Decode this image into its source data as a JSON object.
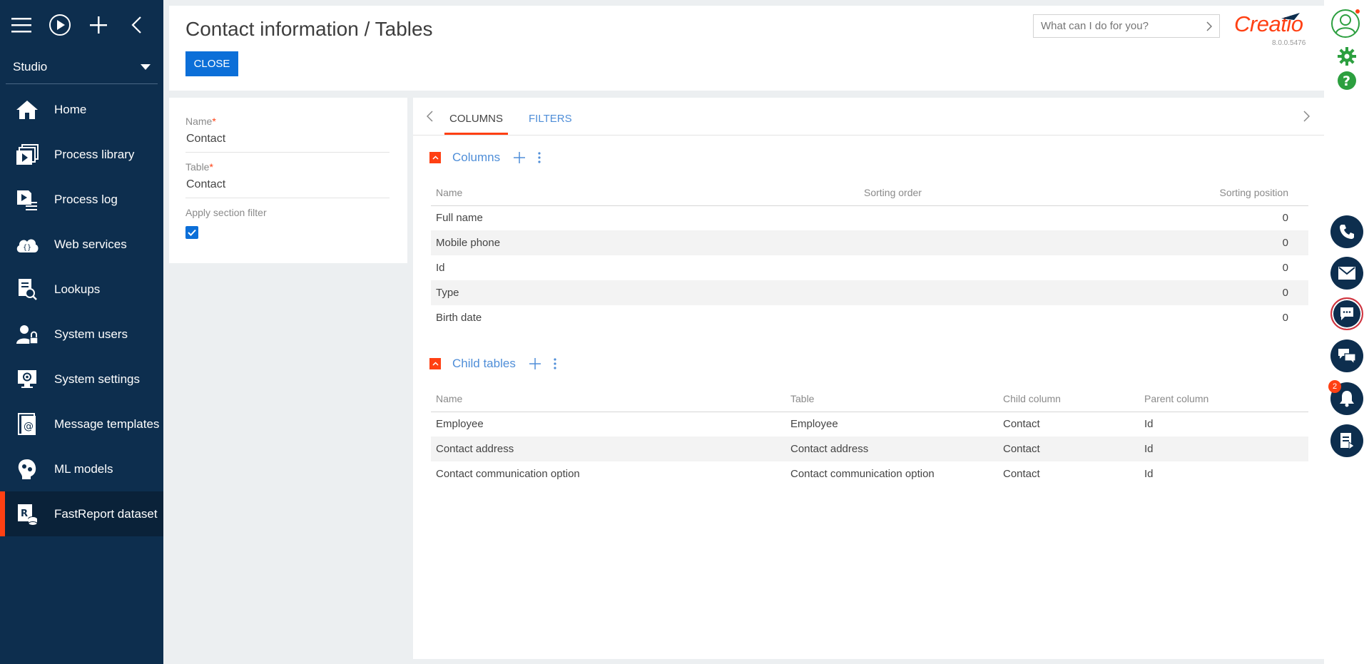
{
  "sidebar": {
    "studio_label": "Studio",
    "items": [
      {
        "label": "Home",
        "icon": "home-icon"
      },
      {
        "label": "Process library",
        "icon": "process-library-icon"
      },
      {
        "label": "Process log",
        "icon": "process-log-icon"
      },
      {
        "label": "Web services",
        "icon": "web-services-icon"
      },
      {
        "label": "Lookups",
        "icon": "lookups-icon"
      },
      {
        "label": "System users",
        "icon": "system-users-icon"
      },
      {
        "label": "System settings",
        "icon": "system-settings-icon"
      },
      {
        "label": "Message templates",
        "icon": "message-templates-icon"
      },
      {
        "label": "ML models",
        "icon": "ml-models-icon"
      },
      {
        "label": "FastReport dataset",
        "icon": "fastreport-dataset-icon"
      }
    ]
  },
  "header": {
    "title": "Contact information / Tables",
    "close_label": "CLOSE",
    "search_placeholder": "What can I do for you?",
    "logo_text": "Creatio",
    "version": "8.0.0.5476"
  },
  "form": {
    "name_label": "Name",
    "name_value": "Contact",
    "table_label": "Table",
    "table_value": "Contact",
    "section_filter_label": "Apply section filter",
    "section_filter_checked": true
  },
  "tabs": {
    "columns": "COLUMNS",
    "filters": "FILTERS"
  },
  "columns_group": {
    "title": "Columns",
    "headers": {
      "name": "Name",
      "order": "Sorting order",
      "position": "Sorting position"
    },
    "rows": [
      {
        "name": "Full name",
        "order": "",
        "position": "0"
      },
      {
        "name": "Mobile phone",
        "order": "",
        "position": "0"
      },
      {
        "name": "Id",
        "order": "",
        "position": "0"
      },
      {
        "name": "Type",
        "order": "",
        "position": "0"
      },
      {
        "name": "Birth date",
        "order": "",
        "position": "0"
      }
    ]
  },
  "child_group": {
    "title": "Child tables",
    "headers": {
      "name": "Name",
      "table": "Table",
      "child": "Child column",
      "parent": "Parent column"
    },
    "rows": [
      {
        "name": "Employee",
        "table": "Employee",
        "child": "Contact",
        "parent": "Id"
      },
      {
        "name": "Contact address",
        "table": "Contact address",
        "child": "Contact",
        "parent": "Id"
      },
      {
        "name": "Contact communication option",
        "table": "Contact communication option",
        "child": "Contact",
        "parent": "Id"
      }
    ]
  },
  "rightrail": {
    "notification_count": "2"
  },
  "colors": {
    "accent": "#ff4013",
    "primary": "#0c6fd8",
    "sidebar": "#0d2e4e",
    "link": "#4f8ed8"
  }
}
